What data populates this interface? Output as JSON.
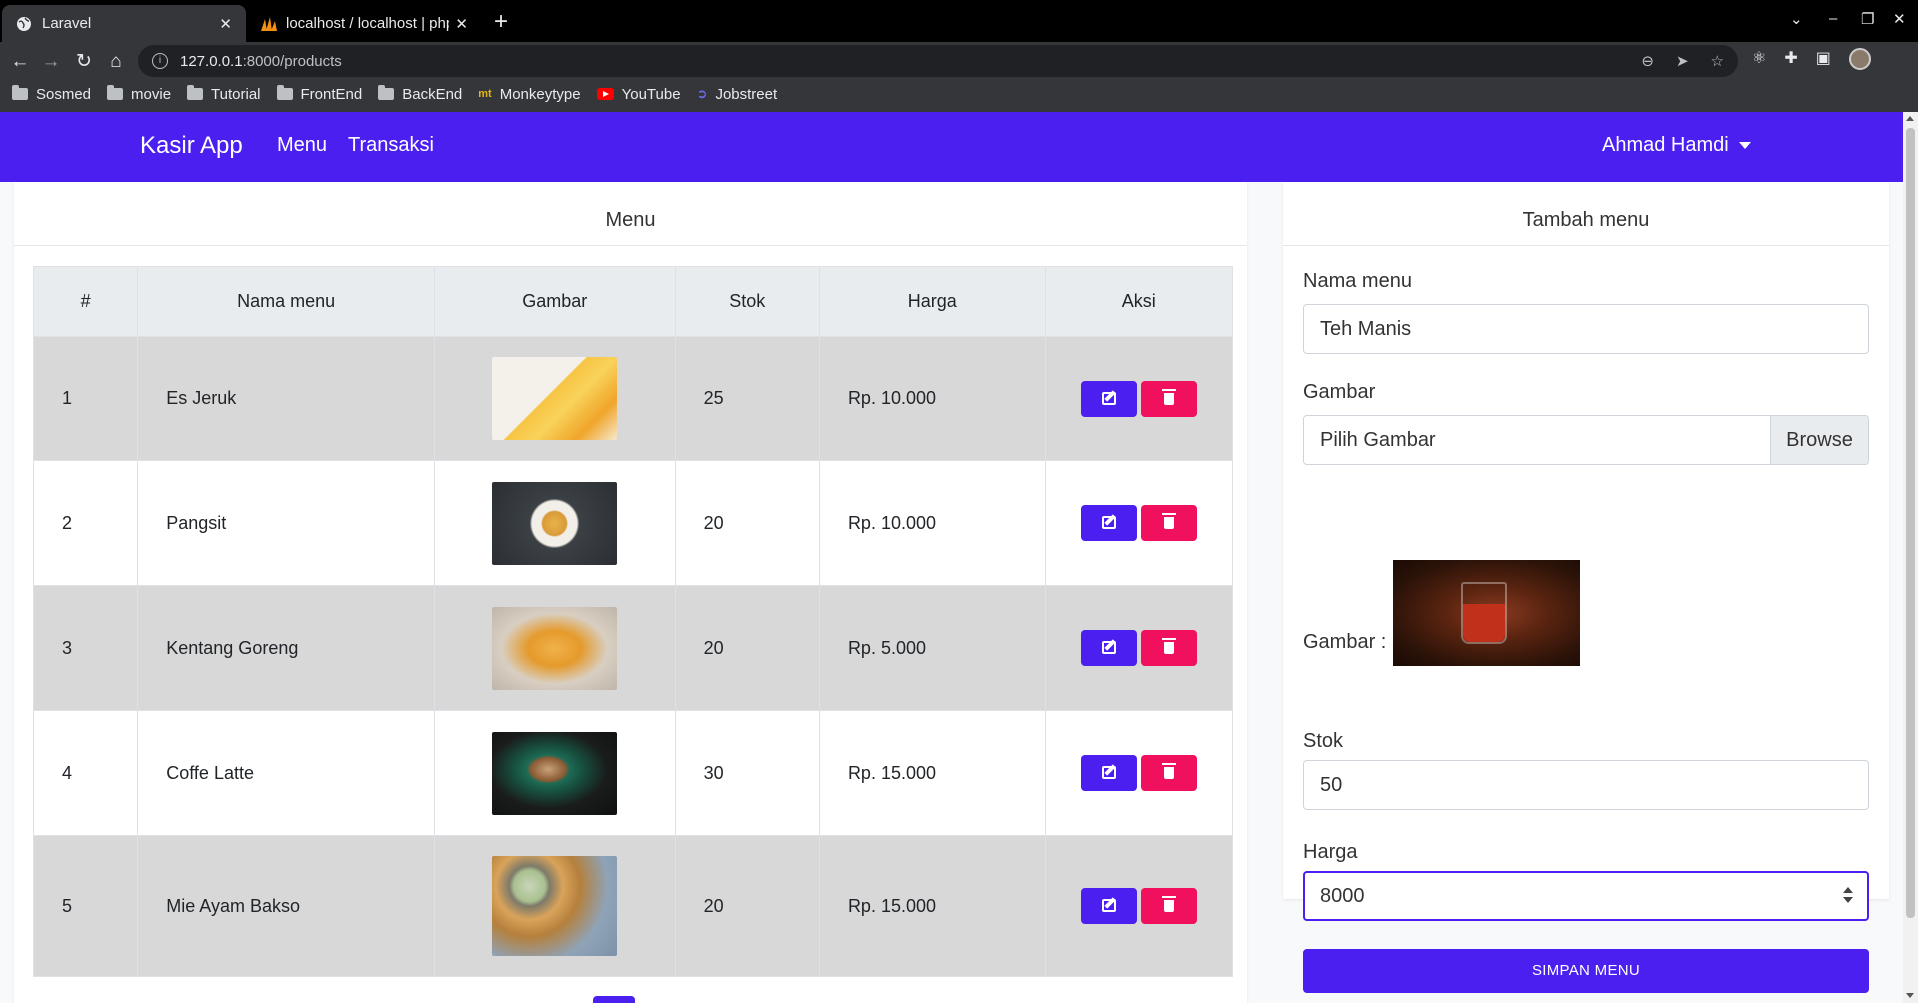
{
  "browser": {
    "tabs": [
      {
        "title": "Laravel",
        "active": true
      },
      {
        "title": "localhost / localhost | phpMyAdmin",
        "active": false
      }
    ],
    "url_host": "127.0.0.1",
    "url_path": ":8000/products",
    "bookmarks": [
      {
        "label": "Sosmed",
        "icon": "folder-icon"
      },
      {
        "label": "movie",
        "icon": "folder-icon"
      },
      {
        "label": "Tutorial",
        "icon": "folder-icon"
      },
      {
        "label": "FrontEnd",
        "icon": "folder-icon"
      },
      {
        "label": "BackEnd",
        "icon": "folder-icon"
      },
      {
        "label": "Monkeytype",
        "icon": "monkeytype-icon"
      },
      {
        "label": "YouTube",
        "icon": "youtube-icon"
      },
      {
        "label": "Jobstreet",
        "icon": "jobstreet-icon"
      }
    ]
  },
  "navbar": {
    "brand": "Kasir App",
    "links": [
      "Menu",
      "Transaksi"
    ],
    "user": "Ahmad Hamdi",
    "color": "#4a1ff0"
  },
  "menu_card": {
    "title": "Menu",
    "columns": [
      "#",
      "Nama menu",
      "Gambar",
      "Stok",
      "Harga",
      "Aksi"
    ],
    "rows": [
      {
        "no": "1",
        "name": "Es Jeruk",
        "image": "orange-juice",
        "stok": "25",
        "harga": "Rp. 10.000"
      },
      {
        "no": "2",
        "name": "Pangsit",
        "image": "dumplings",
        "stok": "20",
        "harga": "Rp. 10.000"
      },
      {
        "no": "3",
        "name": "Kentang Goreng",
        "image": "french-fries",
        "stok": "20",
        "harga": "Rp. 5.000"
      },
      {
        "no": "4",
        "name": "Coffe Latte",
        "image": "latte",
        "stok": "30",
        "harga": "Rp. 15.000"
      },
      {
        "no": "5",
        "name": "Mie Ayam Bakso",
        "image": "noodle-bowl",
        "stok": "20",
        "harga": "Rp. 15.000"
      }
    ]
  },
  "form_card": {
    "title": "Tambah menu",
    "nama_label": "Nama menu",
    "nama_value": "Teh Manis",
    "gambar_label": "Gambar",
    "gambar_placeholder": "Pilih Gambar",
    "browse_label": "Browse",
    "preview_label": "Gambar :",
    "stok_label": "Stok",
    "stok_value": "50",
    "harga_label": "Harga",
    "harga_value": "8000",
    "submit_label": "SIMPAN MENU"
  }
}
